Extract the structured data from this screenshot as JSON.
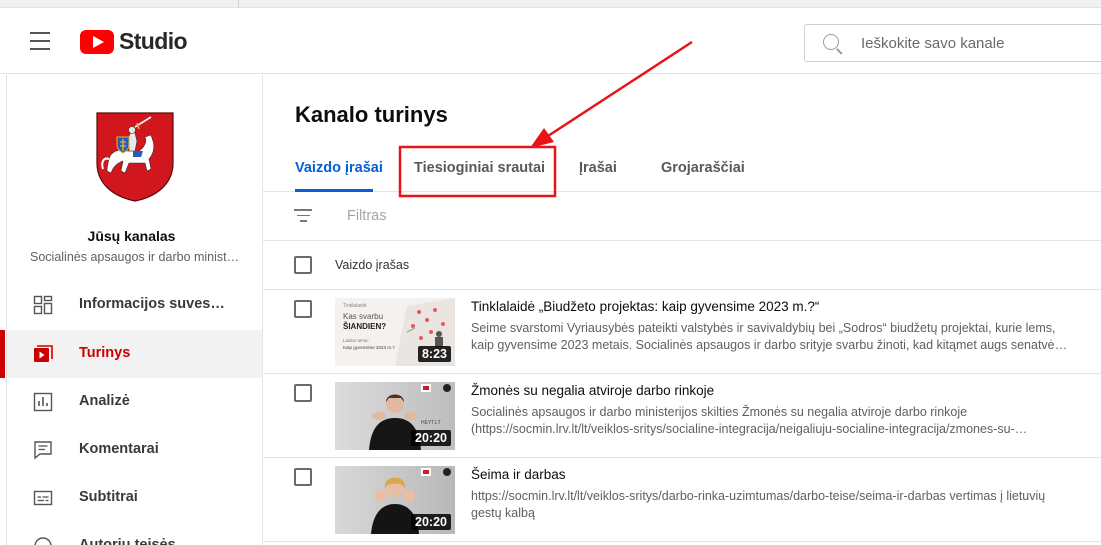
{
  "app": {
    "logo_text": "Studio",
    "search_placeholder": "Ieškokite savo kanale"
  },
  "channel": {
    "name": "Jūsų kanalas",
    "subtitle": "Socialinės apsaugos ir darbo minist…"
  },
  "sidebar": {
    "items": [
      {
        "label": "Informacijos suvesti…",
        "icon": "dashboard-icon"
      },
      {
        "label": "Turinys",
        "icon": "content-icon",
        "active": true
      },
      {
        "label": "Analizė",
        "icon": "analytics-icon"
      },
      {
        "label": "Komentarai",
        "icon": "comments-icon"
      },
      {
        "label": "Subtitrai",
        "icon": "subtitles-icon"
      },
      {
        "label": "Autorių teisės",
        "icon": "copyright-icon"
      }
    ]
  },
  "page": {
    "title": "Kanalo turinys",
    "tabs": [
      {
        "label": "Vaizdo įrašai",
        "active": true
      },
      {
        "label": "Tiesioginiai srautai"
      },
      {
        "label": "Įrašai"
      },
      {
        "label": "Grojaraščiai"
      }
    ],
    "filter_placeholder": "Filtras",
    "column_video": "Vaizdo įrašas"
  },
  "videos": [
    {
      "title": "Tinklalaidė „Biudžeto projektas: kaip gyvensime 2023 m.?“",
      "desc1": "Seime svarstomi Vyriausybės pateikti valstybės ir savivaldybių bei „Sodros“ biudžetų projektai, kurie lems,",
      "desc2": "kaip gyvensime 2023 metais. Socialinės apsaugos ir darbo srityje svarbu žinoti, kad kitąmet augs senatvės…",
      "duration": "8:23",
      "thumb": {
        "small": "Tinklalaidė",
        "line1": "Kas svarbu",
        "line2": "ŠIANDIEN?",
        "line3": "Laidos tema:",
        "line4": "Kaip gyvensime 2023 m.?"
      }
    },
    {
      "title": "Žmonės su negalia atviroje darbo rinkoje",
      "desc1": "Socialinės apsaugos ir darbo ministerijos skilties Žmonės su negalia atviroje darbo rinkoje",
      "desc2": "(https://socmin.lrv.lt/lt/veiklos-sritys/socialine-integracija/neigaliuju-socialine-integracija/zmones-su-…",
      "duration": "20:20",
      "thumb": {
        "watermark": "HEYT.LT"
      }
    },
    {
      "title": "Šeima ir darbas",
      "desc1": "https://socmin.lrv.lt/lt/veiklos-sritys/darbo-rinka-uzimtumas/darbo-teise/seima-ir-darbas vertimas į lietuvių",
      "desc2": "gestų kalbą",
      "duration": "20:20",
      "thumb": {}
    }
  ],
  "colors": {
    "accent_blue": "#065fd4",
    "active_red": "#cc0000",
    "annotation_red": "#e8141a"
  }
}
